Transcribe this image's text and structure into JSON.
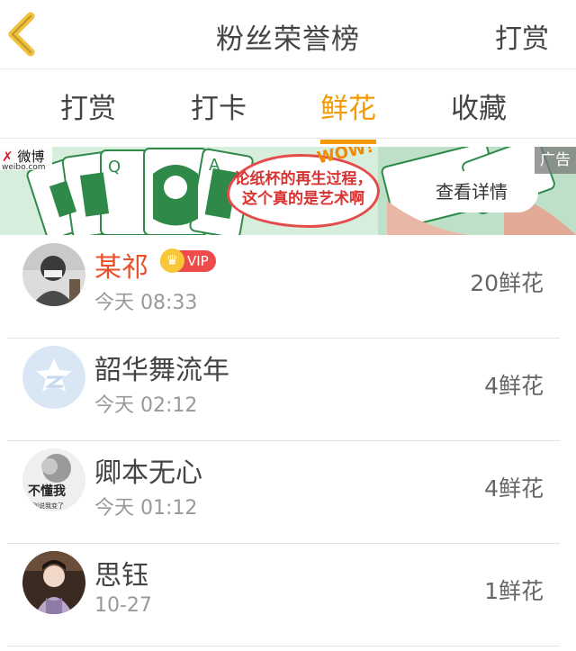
{
  "header": {
    "title": "粉丝荣誉榜",
    "right_action": "打赏"
  },
  "tabs": [
    {
      "label": "打赏",
      "active": false
    },
    {
      "label": "打卡",
      "active": false
    },
    {
      "label": "鲜花",
      "active": true
    },
    {
      "label": "收藏",
      "active": false
    }
  ],
  "ad": {
    "brand": "微博",
    "brand_domain": "weibo.com",
    "wow": "WOW!",
    "headline_line1": "论纸杯的再生过程，",
    "headline_line2": "这个真的是艺术啊",
    "cta": "查看详情",
    "tag": "广告"
  },
  "users": [
    {
      "name": "某祁",
      "vip": true,
      "vip_label": "VIP",
      "time": "今天 08:33",
      "count": "20鲜花"
    },
    {
      "name": "韶华舞流年",
      "vip": false,
      "time": "今天 02:12",
      "count": "4鲜花"
    },
    {
      "name": "卿本无心",
      "vip": false,
      "time": "今天 01:12",
      "count": "4鲜花",
      "avatar_text_1": "不懂我",
      "avatar_text_2": "就别说我变了"
    },
    {
      "name": "思钰",
      "vip": false,
      "time": "10-27",
      "count": "1鲜花"
    }
  ],
  "colors": {
    "accent": "#f39a00",
    "vip_name": "#e8502a",
    "vip_badge": "#ef4b4b"
  }
}
